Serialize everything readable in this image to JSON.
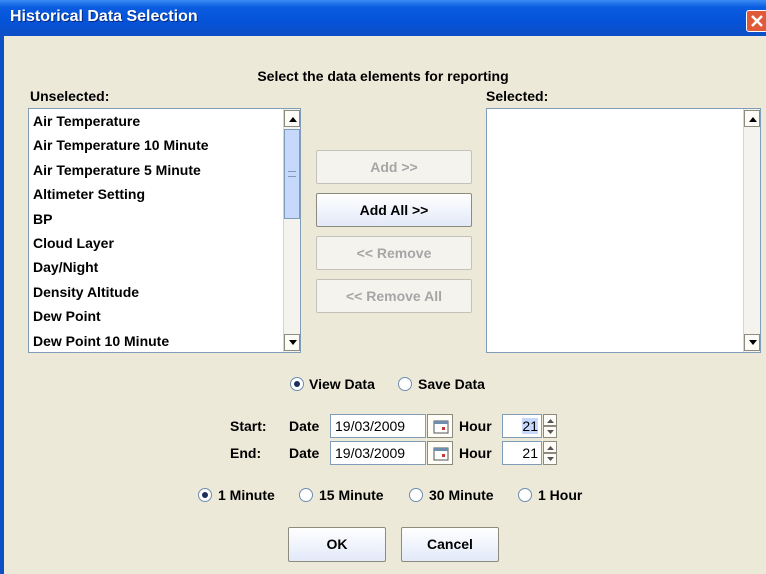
{
  "window": {
    "title": "Historical Data Selection"
  },
  "heading": "Select the data elements for reporting",
  "unselected": {
    "label": "Unselected:",
    "items": [
      "Air Temperature",
      "Air Temperature 10 Minute",
      "Air Temperature 5 Minute",
      "Altimeter Setting",
      "BP",
      "Cloud Layer",
      "Day/Night",
      "Density Altitude",
      "Dew Point",
      "Dew Point 10 Minute"
    ]
  },
  "selected": {
    "label": "Selected:",
    "items": []
  },
  "buttons": {
    "add": "Add >>",
    "add_all": "Add All >>",
    "remove": "<< Remove",
    "remove_all": "<< Remove All",
    "ok": "OK",
    "cancel": "Cancel"
  },
  "mode": {
    "view": "View Data",
    "save": "Save Data",
    "selected": "view"
  },
  "start": {
    "label": "Start:",
    "date_label": "Date",
    "date": "19/03/2009",
    "hour_label": "Hour",
    "hour": "21"
  },
  "end": {
    "label": "End:",
    "date_label": "Date",
    "date": "19/03/2009",
    "hour_label": "Hour",
    "hour": "21"
  },
  "interval": {
    "options": [
      "1 Minute",
      "15 Minute",
      "30 Minute",
      "1 Hour"
    ],
    "selected": "1 Minute"
  },
  "icons": {
    "close": "close-icon",
    "calendar": "calendar-icon",
    "scroll_up": "arrow-up-icon",
    "scroll_down": "arrow-down-icon"
  }
}
